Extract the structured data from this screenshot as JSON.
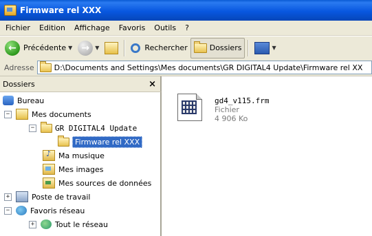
{
  "window": {
    "title": "Firmware rel XXX"
  },
  "menu": [
    "Fichier",
    "Edition",
    "Affichage",
    "Favoris",
    "Outils",
    "?"
  ],
  "toolbar": {
    "back_label": "Précédente",
    "search_label": "Rechercher",
    "folders_label": "Dossiers"
  },
  "address": {
    "label": "Adresse",
    "value": "D:\\Documents and Settings\\Mes documents\\GR DIGITAL4 Update\\Firmware rel XX"
  },
  "folders_panel": {
    "title": "Dossiers",
    "close": "×"
  },
  "tree": [
    {
      "label": "Bureau",
      "expander": ""
    },
    {
      "label": "Mes documents",
      "expander": "−"
    },
    {
      "label": "GR DIGITAL4 Update",
      "expander": "−"
    },
    {
      "label": "Firmware rel XXX",
      "expander": ""
    },
    {
      "label": "Ma musique",
      "expander": ""
    },
    {
      "label": "Mes images",
      "expander": ""
    },
    {
      "label": "Mes sources de données",
      "expander": ""
    },
    {
      "label": "Poste de travail",
      "expander": "+"
    },
    {
      "label": "Favoris réseau",
      "expander": "−"
    },
    {
      "label": "Tout le réseau",
      "expander": "+"
    }
  ],
  "file": {
    "name": "gd4_v115.frm",
    "type": "Fichier",
    "size": "4 906 Ko"
  },
  "colors": {
    "title_bar": "#0a5bd4",
    "selection": "#316ac5",
    "chrome": "#ece9d8"
  }
}
